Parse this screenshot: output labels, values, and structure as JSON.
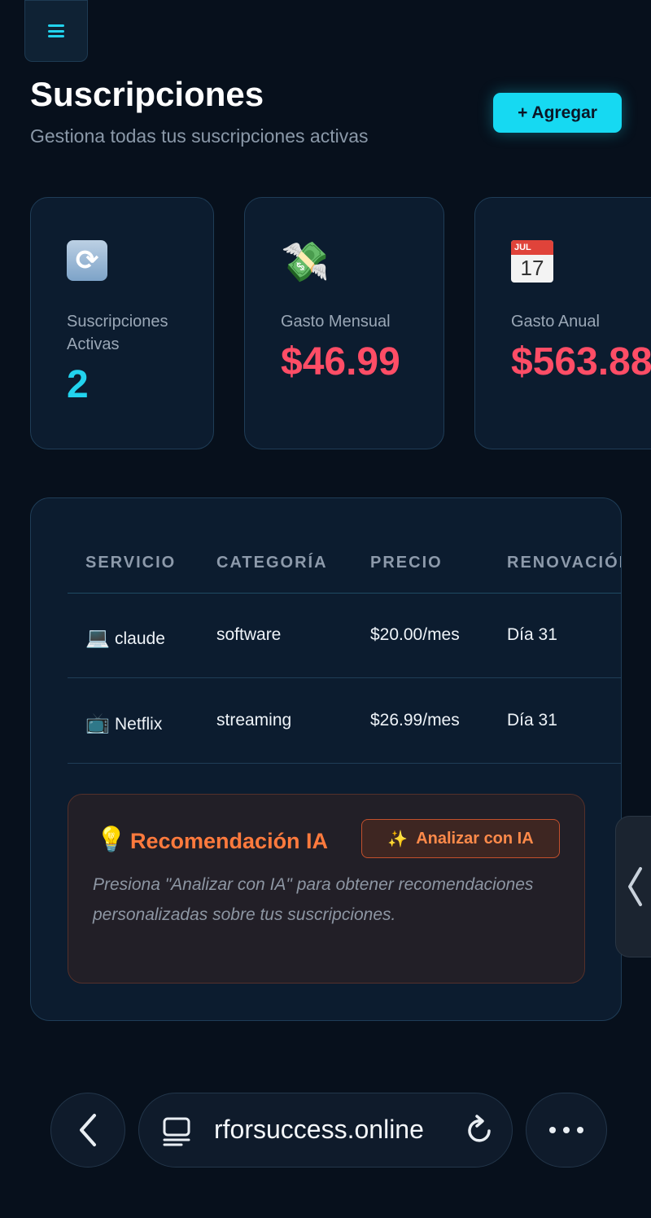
{
  "header": {
    "menu_icon": "hamburger-menu-icon",
    "title": "Suscripciones",
    "subtitle": "Gestiona todas tus suscripciones activas",
    "add_button": "+ Agregar"
  },
  "stats": [
    {
      "icon": "cycle-arrows-icon",
      "label": "Suscripciones Activas",
      "value": "2",
      "color": "#22d3ee"
    },
    {
      "icon": "money-with-wings-icon",
      "label": "Gasto Mensual",
      "value": "$46.99",
      "color": "#ff4d66"
    },
    {
      "icon": "calendar-icon",
      "calendar_month": "JUL",
      "calendar_day": "17",
      "label": "Gasto Anual",
      "value": "$563.88",
      "color": "#ff4d66"
    }
  ],
  "table": {
    "headers": [
      "SERVICIO",
      "CATEGORÍA",
      "PRECIO",
      "RENOVACIÓN"
    ],
    "rows": [
      {
        "icon": "laptop-icon",
        "servicio": "claude",
        "categoria": "software",
        "precio": "$20.00/mes",
        "renovacion": "Día 31"
      },
      {
        "icon": "television-icon",
        "servicio": "Netflix",
        "categoria": "streaming",
        "precio": "$26.99/mes",
        "renovacion": "Día 31"
      }
    ]
  },
  "recommendation": {
    "icon": "lightbulb-icon",
    "title": "Recomendación IA",
    "button_icon": "sparkles-icon",
    "button_label": "Analizar con IA",
    "text": "Presiona \"Analizar con IA\" para obtener recomendaciones personalizadas sobre tus suscripciones."
  },
  "browser": {
    "url": "rforsuccess.online",
    "back_icon": "chevron-left-icon",
    "tabs_icon": "tab-overview-icon",
    "reload_icon": "reload-icon",
    "more_icon": "more-dots-icon",
    "side_handle_icon": "chevron-left-icon"
  }
}
